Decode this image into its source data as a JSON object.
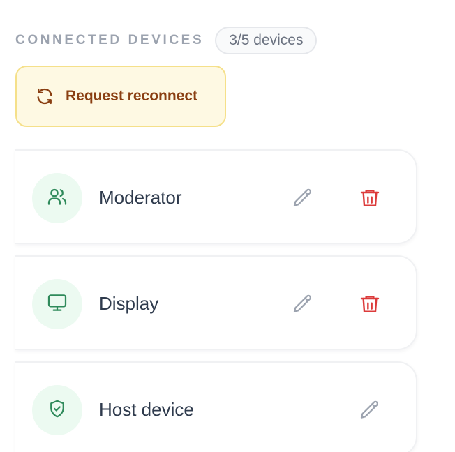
{
  "header": {
    "section_title": "CONNECTED DEVICES",
    "count_badge": "3/5 devices"
  },
  "reconnect_button": {
    "label": "Request reconnect",
    "icon": "refresh-icon"
  },
  "devices": [
    {
      "name": "Moderator",
      "icon": "users-icon",
      "can_edit": true,
      "can_delete": true
    },
    {
      "name": "Display",
      "icon": "monitor-icon",
      "can_edit": true,
      "can_delete": true
    },
    {
      "name": "Host device",
      "icon": "shield-check-icon",
      "can_edit": true,
      "can_delete": false
    }
  ],
  "colors": {
    "accent_green": "#2f8a5b",
    "avatar_bg": "#ecfaf1",
    "delete_red": "#dc3b3b",
    "edit_gray": "#9ca3af",
    "reconnect_text": "#8a3f12",
    "reconnect_bg": "#fef9e3",
    "reconnect_border": "#f5e08a"
  }
}
